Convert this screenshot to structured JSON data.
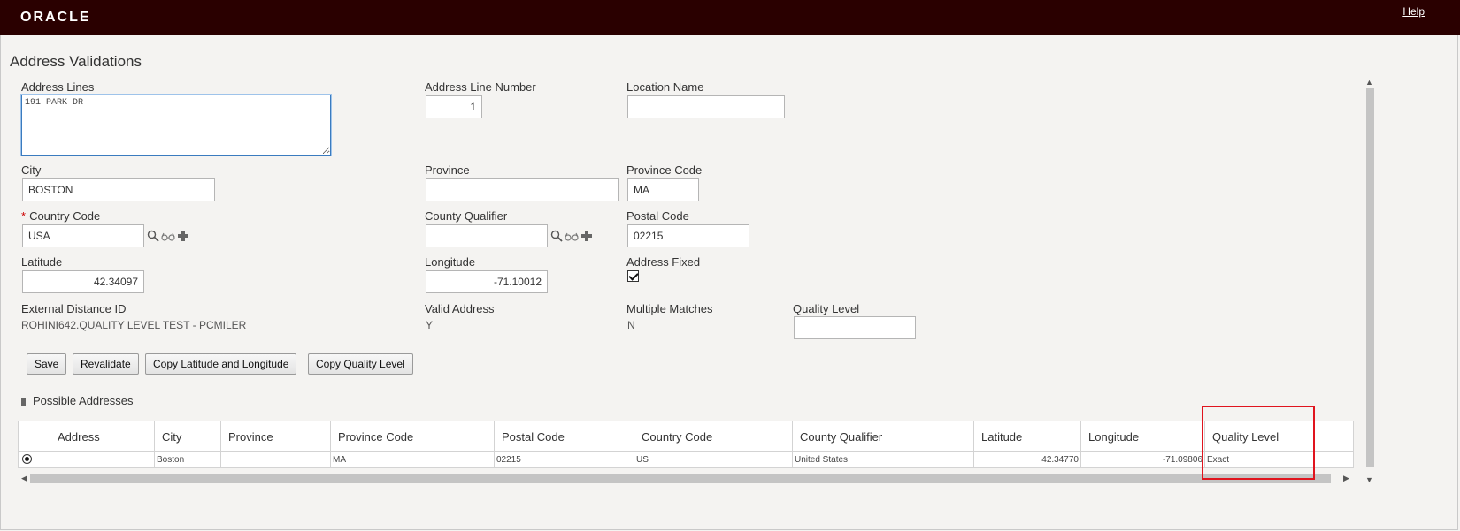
{
  "header": {
    "logo": "ORACLE",
    "help_label": "Help"
  },
  "page_title": "Address Validations",
  "form": {
    "address_lines": {
      "label": "Address Lines",
      "value": "191 PARK DR"
    },
    "address_line_number": {
      "label": "Address Line Number",
      "value": "1"
    },
    "location_name": {
      "label": "Location Name",
      "value": ""
    },
    "city": {
      "label": "City",
      "value": "BOSTON"
    },
    "province": {
      "label": "Province",
      "value": ""
    },
    "province_code": {
      "label": "Province Code",
      "value": "MA"
    },
    "country_code": {
      "label": "Country Code",
      "required_mark": "*",
      "value": "USA"
    },
    "county_qualifier": {
      "label": "County Qualifier",
      "value": ""
    },
    "postal_code": {
      "label": "Postal Code",
      "value": "02215"
    },
    "latitude": {
      "label": "Latitude",
      "value": "42.34097"
    },
    "longitude": {
      "label": "Longitude",
      "value": "-71.10012"
    },
    "address_fixed": {
      "label": "Address Fixed",
      "checked": true
    },
    "external_distance_id": {
      "label": "External Distance ID",
      "value": "ROHINI642.QUALITY LEVEL TEST - PCMILER"
    },
    "valid_address": {
      "label": "Valid Address",
      "value": "Y"
    },
    "multiple_matches": {
      "label": "Multiple Matches",
      "value": "N"
    },
    "quality_level": {
      "label": "Quality Level",
      "value": ""
    }
  },
  "buttons": {
    "save": "Save",
    "revalidate": "Revalidate",
    "copy_lat_long": "Copy Latitude and Longitude",
    "copy_quality": "Copy Quality Level"
  },
  "possible_addresses": {
    "title": "Possible Addresses",
    "columns": [
      "Address",
      "City",
      "Province",
      "Province Code",
      "Postal Code",
      "Country Code",
      "County Qualifier",
      "Latitude",
      "Longitude",
      "Quality Level"
    ],
    "rows": [
      {
        "selected": true,
        "cells": [
          "",
          "Boston",
          "",
          "MA",
          "02215",
          "US",
          "United States",
          "42.34770",
          "-71.09806",
          "Exact"
        ]
      }
    ]
  },
  "colors": {
    "topbar": "#2a0000",
    "highlight": "#e0141e"
  }
}
